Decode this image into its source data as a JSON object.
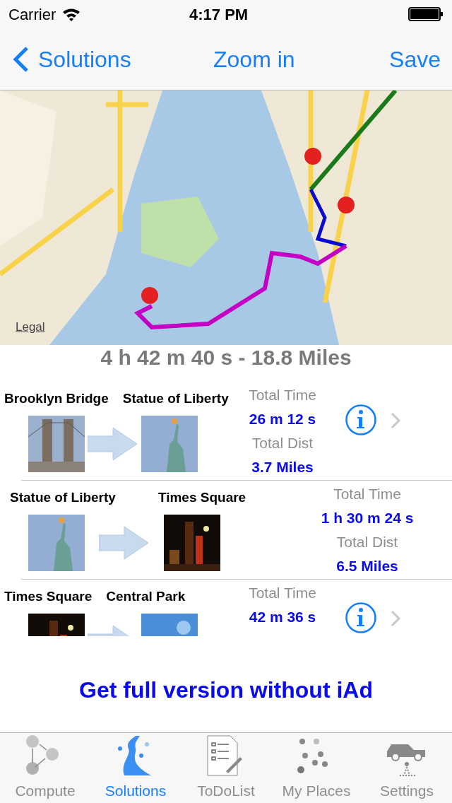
{
  "status_bar": {
    "carrier": "Carrier",
    "time": "4:17 PM"
  },
  "nav": {
    "back": "Solutions",
    "title": "Zoom in",
    "action": "Save"
  },
  "map": {
    "kind": "picture",
    "legal": "Legal"
  },
  "summary": "4 h 42 m 40 s - 18.8 Miles",
  "legs": [
    {
      "from": "Brooklyn Bridge",
      "to": "Statue of Liberty",
      "time_label": "Total Time",
      "time": "26 m 12 s",
      "dist_label": "Total Dist",
      "dist": "3.7 Miles",
      "show_info": true
    },
    {
      "from": "Statue of Liberty",
      "to": "Times Square",
      "time_label": "Total Time",
      "time": "1 h 30 m 24 s",
      "dist_label": "Total Dist",
      "dist": "6.5 Miles",
      "show_info": false
    },
    {
      "from": "Times Square",
      "to": "Central Park",
      "time_label": "Total Time",
      "time": "42 m 36 s",
      "show_info": true
    }
  ],
  "ad_link": "Get full version without iAd",
  "tabs": [
    {
      "label": "Compute",
      "selected": false
    },
    {
      "label": "Solutions",
      "selected": true
    },
    {
      "label": "ToDoList",
      "selected": false
    },
    {
      "label": "My Places",
      "selected": false
    },
    {
      "label": "Settings",
      "selected": false
    }
  ]
}
